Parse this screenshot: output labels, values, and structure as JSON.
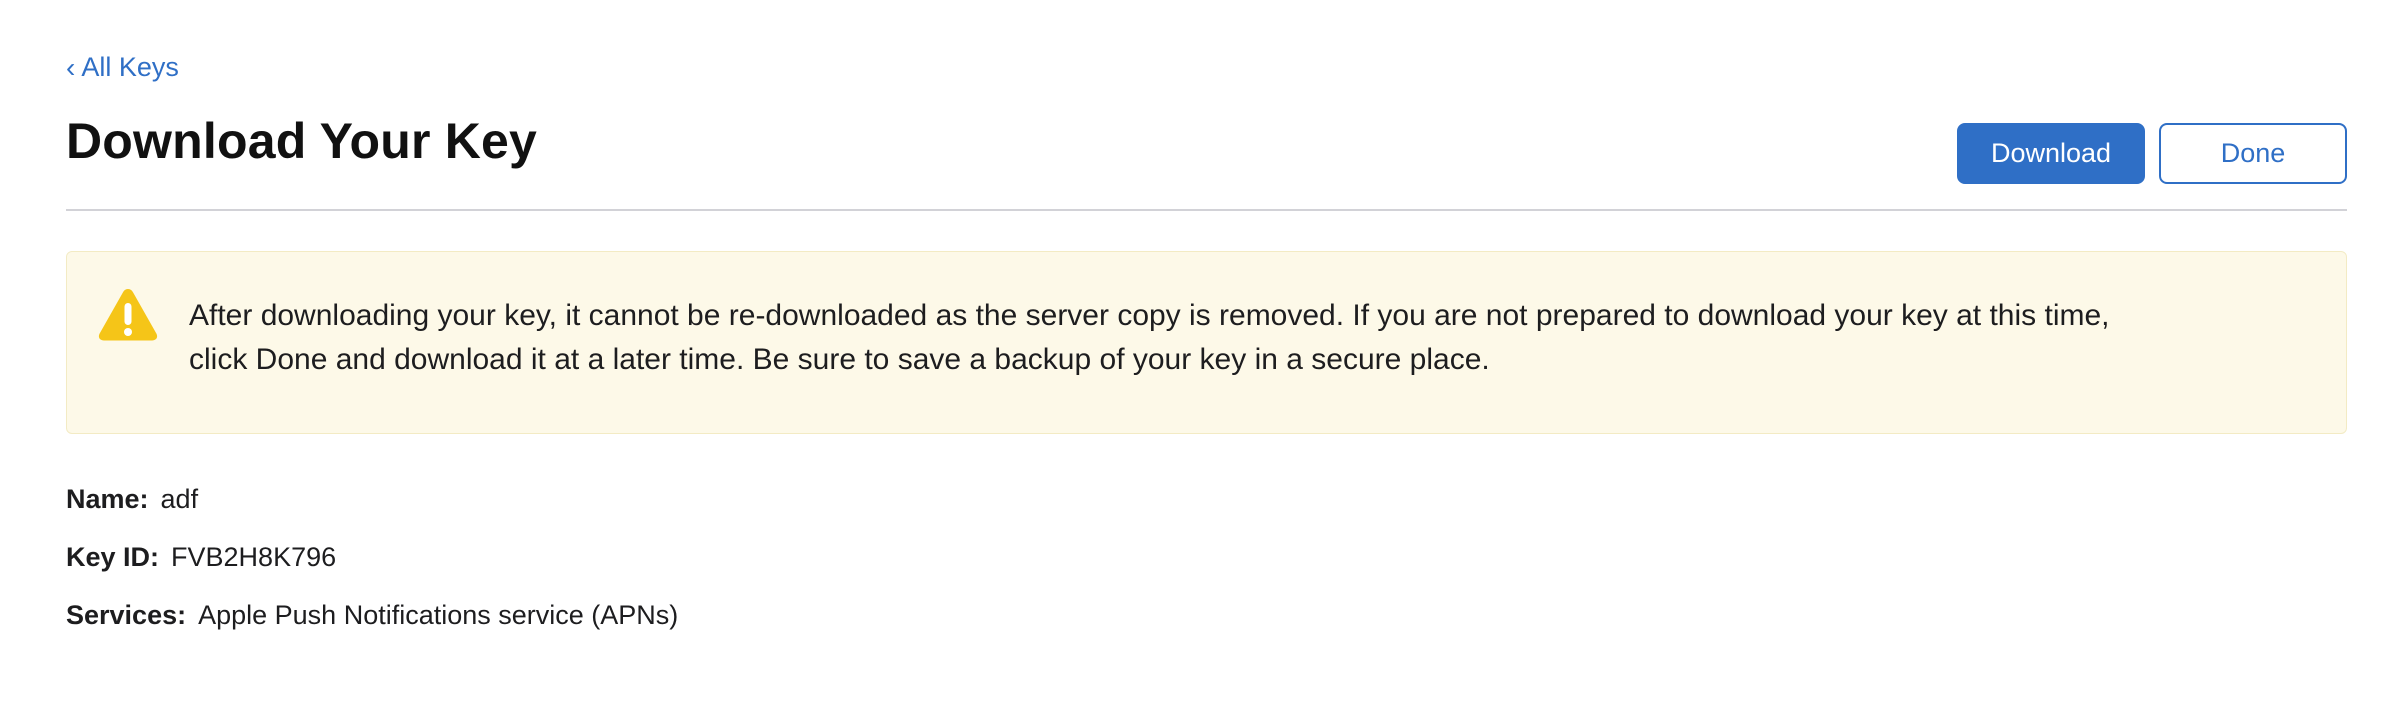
{
  "nav": {
    "back_chevron": "‹",
    "back_label": "All Keys"
  },
  "header": {
    "title": "Download Your Key",
    "download_label": "Download",
    "done_label": "Done"
  },
  "alert": {
    "icon": "warning-triangle-icon",
    "icon_color": "#f5c518",
    "text": "After downloading your key, it cannot be re-downloaded as the server copy is removed. If you are not prepared to download your key at this time, click Done and download it at a later time. Be sure to save a backup of your key in a secure place."
  },
  "details": {
    "name_label": "Name:",
    "name_value": "adf",
    "key_id_label": "Key ID:",
    "key_id_value": "FVB2H8K796",
    "services_label": "Services:",
    "services_value": "Apple Push Notifications service (APNs)"
  },
  "colors": {
    "accent": "#2f6fc6",
    "alert_background": "#fdf9e8"
  }
}
